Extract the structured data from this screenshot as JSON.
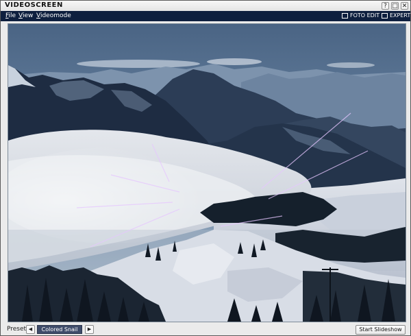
{
  "app": {
    "title": "VIDEOSCREEN"
  },
  "window_controls": {
    "help": "?",
    "restore": "□",
    "close": "✕"
  },
  "menu": {
    "file": {
      "first": "F",
      "rest": "ile"
    },
    "view": {
      "first": "V",
      "rest": "iew"
    },
    "videomode": {
      "first": "V",
      "rest": "ideomode"
    }
  },
  "modes": [
    {
      "label": "FOTO EDIT",
      "checked": false
    },
    {
      "label": "EXPERT",
      "checked": false
    }
  ],
  "photo": {
    "icon": "mountain-landscape-image"
  },
  "bottom": {
    "preset_label": "Preset",
    "preset_prev": "◀",
    "preset_value": "Colored Snail",
    "preset_next": "▶",
    "slideshow_label": "Start Slideshow"
  },
  "colors": {
    "menubar": "#0e1f3e",
    "preset_bg": "#3f4c6a"
  }
}
